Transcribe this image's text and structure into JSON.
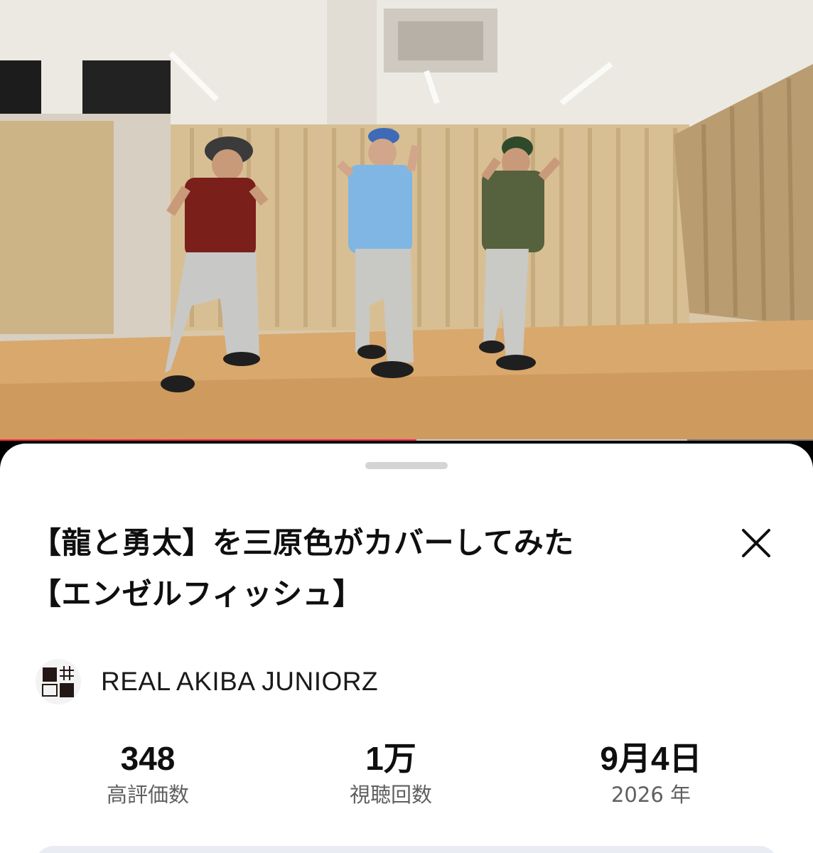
{
  "player": {
    "progress_fraction": 0.512,
    "buffered_fraction": 0.845,
    "accent_color": "#ff2a3c"
  },
  "sheet": {
    "title_line1": "【龍と勇太】を三原色がカバーしてみた",
    "title_line2": "【エンゼルフィッシュ】",
    "close_icon": "close-icon"
  },
  "channel": {
    "name": "REAL AKIBA JUNIORZ",
    "avatar_icon": "channel-logo-icon"
  },
  "stats": {
    "likes_value": "348",
    "likes_label": "高評価数",
    "views_value": "1万",
    "views_label": "視聴回数",
    "date_value": "9月4日",
    "date_label": "2026 年"
  }
}
